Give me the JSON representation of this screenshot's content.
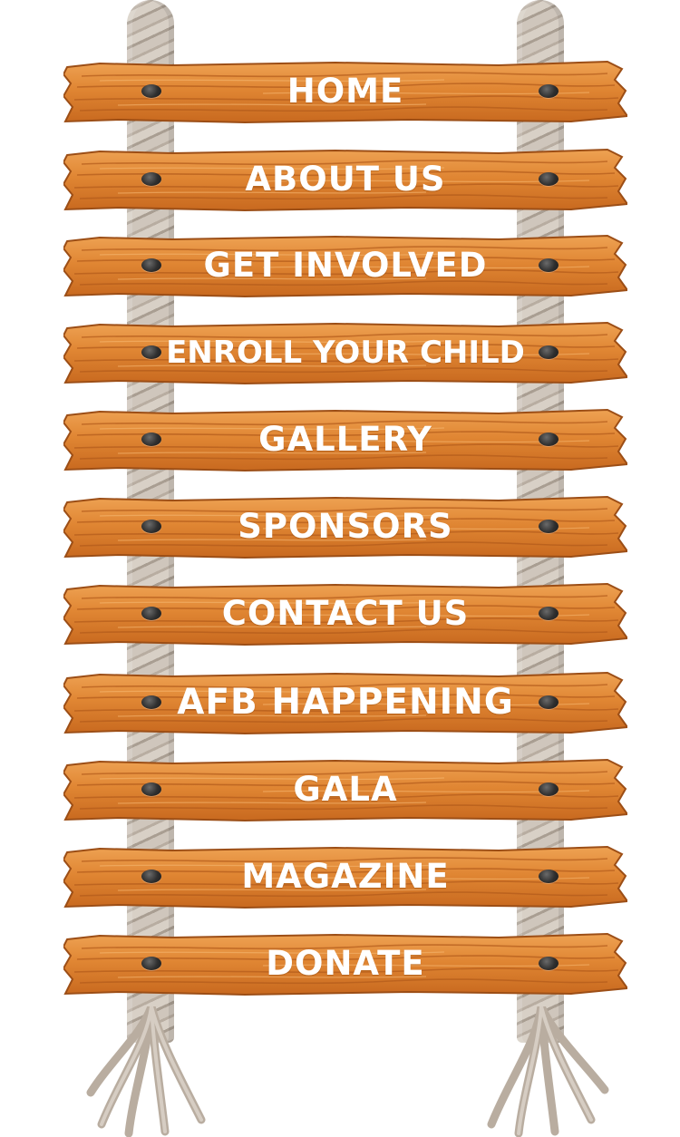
{
  "nav": {
    "items": [
      {
        "label": "HOME"
      },
      {
        "label": "ABOUT US"
      },
      {
        "label": "GET INVOLVED"
      },
      {
        "label": "ENROLL YOUR CHILD"
      },
      {
        "label": "GALLERY"
      },
      {
        "label": "SPONSORS"
      },
      {
        "label": "CONTACT US"
      },
      {
        "label": "AFB HAPPENING"
      },
      {
        "label": "GALA"
      },
      {
        "label": "MAGAZINE"
      },
      {
        "label": "DONATE"
      }
    ]
  },
  "colors": {
    "wood_light": "#e5913f",
    "wood_mid": "#d87a26",
    "wood_dark": "#a9551a",
    "rope": "#cfc6bc",
    "nail": "#2f2f2f",
    "label_text": "#ffffff"
  }
}
